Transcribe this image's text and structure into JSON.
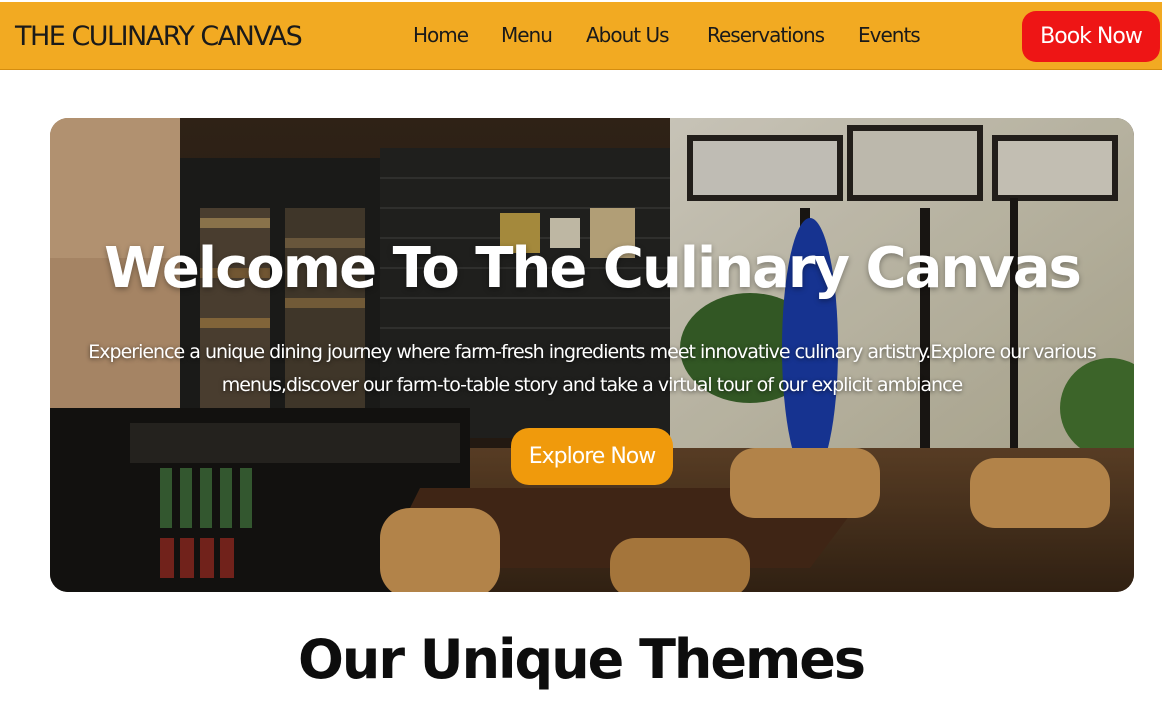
{
  "brand": {
    "name": "THE CULINARY CANVAS"
  },
  "nav": {
    "links": [
      "Home",
      "Menu",
      "About Us",
      "Reservations",
      "Events"
    ],
    "cta_label": "Book Now"
  },
  "hero": {
    "title": "Welcome To The Culinary Canvas",
    "description": "Experience a unique dining journey where farm-fresh ingredients meet innovative culinary artistry.Explore our various menus,discover our farm-to-table story and take a virtual tour of our explicit ambiance",
    "button_label": "Explore Now"
  },
  "themes": {
    "title": "Our Unique Themes"
  },
  "colors": {
    "navbar_bg": "#f2aa22",
    "book_button": "#ee1515",
    "explore_button": "#f09a0c"
  }
}
